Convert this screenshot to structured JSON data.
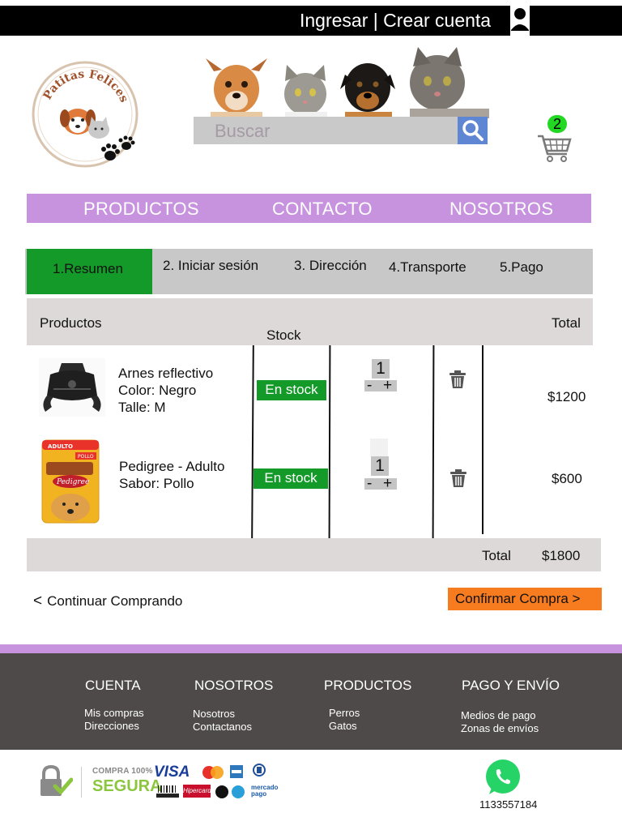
{
  "topbar": {
    "auth_text": "Ingresar  | Crear cuenta",
    "user_icon": "user-icon"
  },
  "header": {
    "logo_text": "Patitas Felices",
    "search_placeholder": "Buscar",
    "search_icon": "search-icon",
    "cart_icon": "cart-icon",
    "cart_count": "2"
  },
  "nav": {
    "items": [
      "PRODUCTOS",
      "CONTACTO",
      "NOSOTROS"
    ]
  },
  "steps": {
    "active_index": 0,
    "items": [
      "1.Resumen",
      "2. Iniciar sesión",
      "3. Dirección",
      "4.Transporte",
      "5.Pago"
    ]
  },
  "table": {
    "headers": {
      "products": "Productos",
      "stock": "Stock",
      "total": "Total"
    },
    "rows": [
      {
        "image": "harness-image",
        "name_lines": [
          "Arnes reflectivo",
          "Color: Negro",
          "Talle: M"
        ],
        "stock": "En stock",
        "qty": "1",
        "minus": "-",
        "plus": "+",
        "price": "$1200"
      },
      {
        "image": "pedigree-pouch-image",
        "name_lines": [
          "Pedigree - Adulto",
          "Sabor: Pollo"
        ],
        "stock": "En stock",
        "qty": "1",
        "minus": "-",
        "plus": "+",
        "price": "$600"
      }
    ],
    "footer": {
      "label": "Total",
      "value": "$1800"
    }
  },
  "actions": {
    "continue": "Continuar Comprando",
    "continue_chevron": "<",
    "confirm": "Confirmar Compra >"
  },
  "footer": {
    "columns": [
      {
        "title": "CUENTA",
        "links": [
          "Mis compras",
          "Direcciones"
        ]
      },
      {
        "title": "NOSOTROS",
        "links": [
          "Nosotros",
          "Contactanos"
        ]
      },
      {
        "title": "PRODUCTOS",
        "links": [
          "Perros",
          "Gatos"
        ]
      },
      {
        "title": "PAGO Y ENVÍO",
        "links": [
          "Medios de pago",
          "Zonas de envíos"
        ]
      }
    ],
    "secure_badge": {
      "line1": "COMPRA 100%",
      "line2": "SEGURA",
      "visa": "VISA",
      "mercado": "mercado pago",
      "boleto": "BOLETO",
      "hipercard": "Hipercard"
    },
    "whatsapp_icon": "whatsapp-icon",
    "phone": "1133557184"
  },
  "colors": {
    "nav": "#c792de",
    "active_step": "#149a29",
    "confirm": "#f77b1f",
    "footer": "#4f4a4a",
    "search_button": "#5f86d3",
    "cart_badge": "#22d822"
  }
}
